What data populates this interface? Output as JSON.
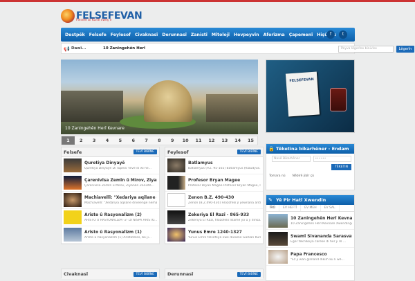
{
  "brand": {
    "name": "FELSEFEVAN",
    "tagline": "Felsefe bi Kurdî xweş e"
  },
  "nav": {
    "items": [
      "Destpêk",
      "Felsefe",
      "Feylesof",
      "Civaknasî",
      "Derunnasî",
      "Zanistî",
      "Mîtolojî",
      "Hevpeyvîn",
      "Aforîzma",
      "Çapemenî",
      "Hişûnas"
    ],
    "social": [
      "f",
      "t"
    ]
  },
  "newsbar": {
    "label": "Dawî...",
    "headline": "10 Zaningehên Herî",
    "search_placeholder": "Peyva lêgerîne binivîse",
    "search_button": "Lêgerîn"
  },
  "slider": {
    "caption": "10 Zaningehên Herî Kevnare",
    "pages": [
      "1",
      "2",
      "3",
      "4",
      "5",
      "6",
      "7",
      "8",
      "9",
      "10",
      "11",
      "12",
      "13",
      "14",
      "15"
    ],
    "active_page": "1",
    "book_title": "FELSEFEVAN"
  },
  "sections": {
    "felsefe": {
      "title": "Felsefe",
      "more": "TEVÎ BIBÎNE",
      "items": [
        {
          "title": "Quretiya Dinyayê",
          "desc": "Quretiya Dinyayê   Di rûpela 'tevê di wi he..."
        },
        {
          "title": "Çarenivîsa Zemîn û Mirov, Ziyanên...",
          "desc": "Çarenivîsa Zemîn û Mirov, Ziyanên Zanistê..."
        },
        {
          "title": "Machiavellî: \"Xedariya aqilane dil...",
          "desc": "Machiavellî: \"Xedariya aqilane dilveenge nema..."
        },
        {
          "title": "Arîsto û Rasyonalîzm (2)",
          "desc": "ARÎSTO Û RASYONALÎZM -2- DI NÎSPA ARÎSTO..."
        },
        {
          "title": "Arîsto û Rasyonalîzm (1)",
          "desc": "Arîsto û Rasyonalîzm (1)        Arîstoteles, bo ji..."
        }
      ]
    },
    "feylesof": {
      "title": "Feylesof",
      "more": "TEVÎ BIBÎNE",
      "items": [
        {
          "title": "Batlamyus",
          "desc": "Batlamyus (P.Z. 95-165) Batlamyus (Klaudyus..."
        },
        {
          "title": "Profesor Bryan Magee",
          "desc": "Profesor Bryan Magee Profesor Bryan Magee, li..."
        },
        {
          "title": "Zenon B.Z. 490-430",
          "desc": "Zenon (B.Z.490-430) Filozofekî jî yewnana antîk..."
        },
        {
          "title": "Zekeriya El Razî - 865-933",
          "desc": "Zekeriya El Razî, filozofekî Îslamê yo û ji dinka..."
        },
        {
          "title": "Yunus Emre 1240-1327",
          "desc": "Yunus Emre felsefeya xwe dixwîne Gûrkan Kurî..."
        }
      ]
    },
    "civaknasi": {
      "title": "Civaknasî",
      "more": "TEVÎ BIBÎNE"
    },
    "derunnasi": {
      "title": "Derunnasî",
      "more": "TEVÎ BIBÎNE"
    }
  },
  "login": {
    "title": "Têketina bikarhêner - Endam",
    "username_label": "Navê Bikarhêner",
    "password_value": "••••••",
    "submit": "TÊKETIN",
    "remember": "Tomara nû",
    "forgot": "Nêbîrê jibîr çû"
  },
  "popular": {
    "title": "Yê Pir Hatî Xwendin",
    "tabs": [
      "ÎRO",
      "EV HEFTÎ",
      "EV MEH",
      "EV SAL"
    ],
    "items": [
      {
        "title": "10 Zaningehên Herî Kevnare",
        "desc": "10 Zaningehên Herî Kevnare Xwendinge..."
      },
      {
        "title": "Swamî Sivananda Sarasvatî",
        "desc": "Eger teknîkeya careke di her ji rê ..."
      },
      {
        "title": "Papa Francesco",
        "desc": "\"Ez ji wan gîsnand dikim ku li wê..."
      }
    ]
  }
}
